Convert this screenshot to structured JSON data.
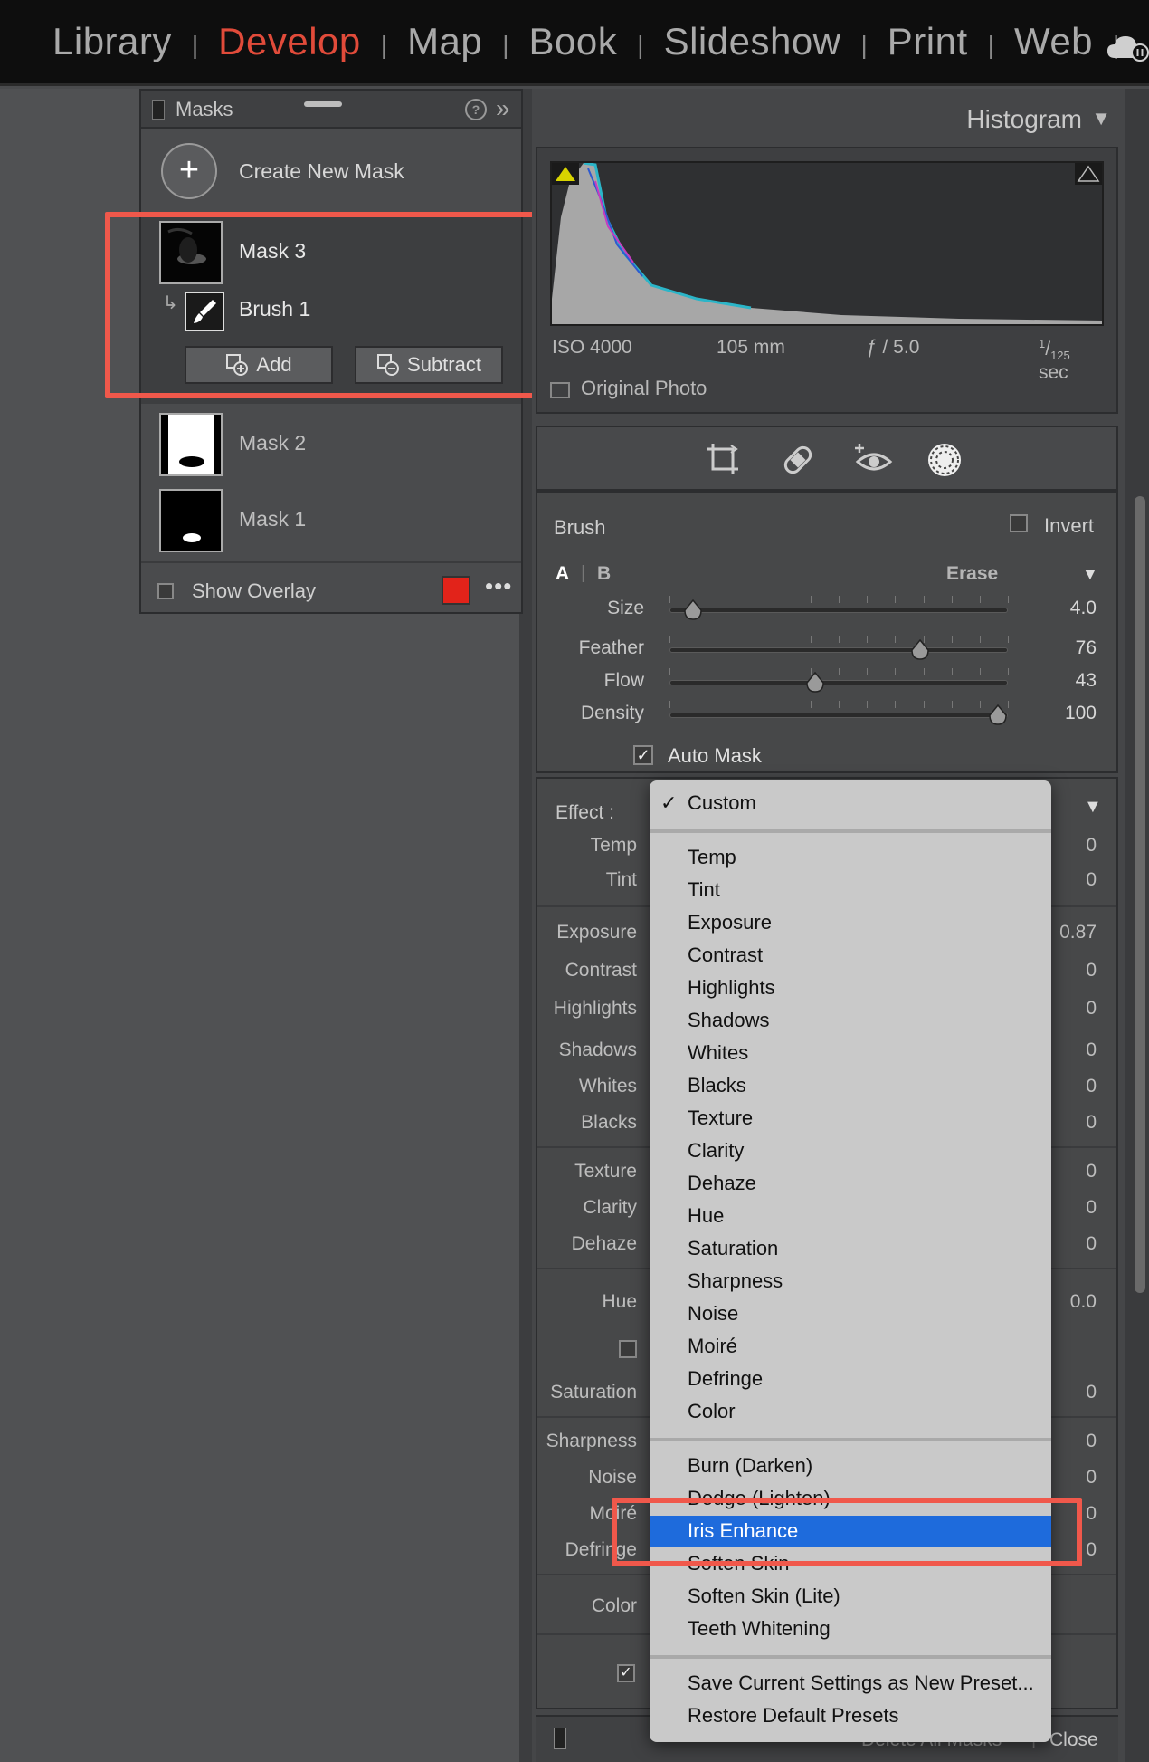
{
  "top_nav": {
    "modules": [
      {
        "label": "Library",
        "active": false
      },
      {
        "label": "Develop",
        "active": true
      },
      {
        "label": "Map",
        "active": false
      },
      {
        "label": "Book",
        "active": false
      },
      {
        "label": "Slideshow",
        "active": false
      },
      {
        "label": "Print",
        "active": false
      },
      {
        "label": "Web",
        "active": false
      }
    ],
    "separator": "|",
    "active_color": "#e14b3a"
  },
  "masks_panel": {
    "title": "Masks",
    "create_label": "Create New Mask",
    "create_icon": "+",
    "help_icon": "?",
    "expand_icon": "»",
    "masks": [
      {
        "label": "Mask 3",
        "selected": true,
        "components": [
          {
            "label": "Brush 1"
          }
        ]
      },
      {
        "label": "Mask 2",
        "selected": false
      },
      {
        "label": "Mask 1",
        "selected": false
      }
    ],
    "add_label": "Add",
    "subtract_label": "Subtract",
    "show_overlay_label": "Show Overlay",
    "overlay_color": "#e2231a",
    "more_icon": "•••"
  },
  "histogram": {
    "title": "Histogram",
    "iso": "ISO 4000",
    "focal": "105 mm",
    "aperture": "ƒ / 5.0",
    "shutter_num": "1",
    "shutter_den": "125",
    "shutter_unit": " sec",
    "original_photo_label": "Original Photo"
  },
  "brush": {
    "title": "Brush",
    "invert_label": "Invert",
    "tab_a": "A",
    "tab_b": "B",
    "erase_label": "Erase",
    "sliders": [
      {
        "label": "Size",
        "value": "4.0",
        "fraction": 0.07
      },
      {
        "label": "Feather",
        "value": "76",
        "fraction": 0.74
      },
      {
        "label": "Flow",
        "value": "43",
        "fraction": 0.43
      },
      {
        "label": "Density",
        "value": "100",
        "fraction": 0.97
      }
    ],
    "auto_mask_label": "Auto Mask",
    "auto_mask_checked": true
  },
  "effect": {
    "label": "Effect :",
    "rows": [
      {
        "label": "Temp",
        "value": "0"
      },
      {
        "label": "Tint",
        "value": "0"
      },
      {
        "label": "Exposure",
        "value": "0.87"
      },
      {
        "label": "Contrast",
        "value": "0"
      },
      {
        "label": "Highlights",
        "value": "0"
      },
      {
        "label": "Shadows",
        "value": "0"
      },
      {
        "label": "Whites",
        "value": "0"
      },
      {
        "label": "Blacks",
        "value": "0"
      },
      {
        "label": "Texture",
        "value": "0"
      },
      {
        "label": "Clarity",
        "value": "0"
      },
      {
        "label": "Dehaze",
        "value": "0"
      },
      {
        "label": "Hue",
        "value": "0.0"
      },
      {
        "label": "Saturation",
        "value": "0"
      },
      {
        "label": "Sharpness",
        "value": "0"
      },
      {
        "label": "Noise",
        "value": "0"
      },
      {
        "label": "Moiré",
        "value": "0"
      },
      {
        "label": "Defringe",
        "value": "0"
      },
      {
        "label": "Color",
        "value": ""
      }
    ]
  },
  "bottom": {
    "delete_all_label": "Delete All Masks",
    "separator": "|",
    "close_label": "Close"
  },
  "dropdown": {
    "checked_item": "Custom",
    "groups": [
      [
        "Custom"
      ],
      [
        "Temp",
        "Tint",
        "Exposure",
        "Contrast",
        "Highlights",
        "Shadows",
        "Whites",
        "Blacks",
        "Texture",
        "Clarity",
        "Dehaze",
        "Hue",
        "Saturation",
        "Sharpness",
        "Noise",
        "Moiré",
        "Defringe",
        "Color"
      ],
      [
        "Burn (Darken)",
        "Dodge (Lighten)",
        "Iris Enhance",
        "Soften Skin",
        "Soften Skin (Lite)",
        "Teeth Whitening"
      ],
      [
        "Save Current Settings as New Preset...",
        "Restore Default Presets"
      ]
    ],
    "highlighted_item": "Iris Enhance",
    "highlight_color": "#1e6bdc"
  },
  "annotation_color": "#f0584b"
}
